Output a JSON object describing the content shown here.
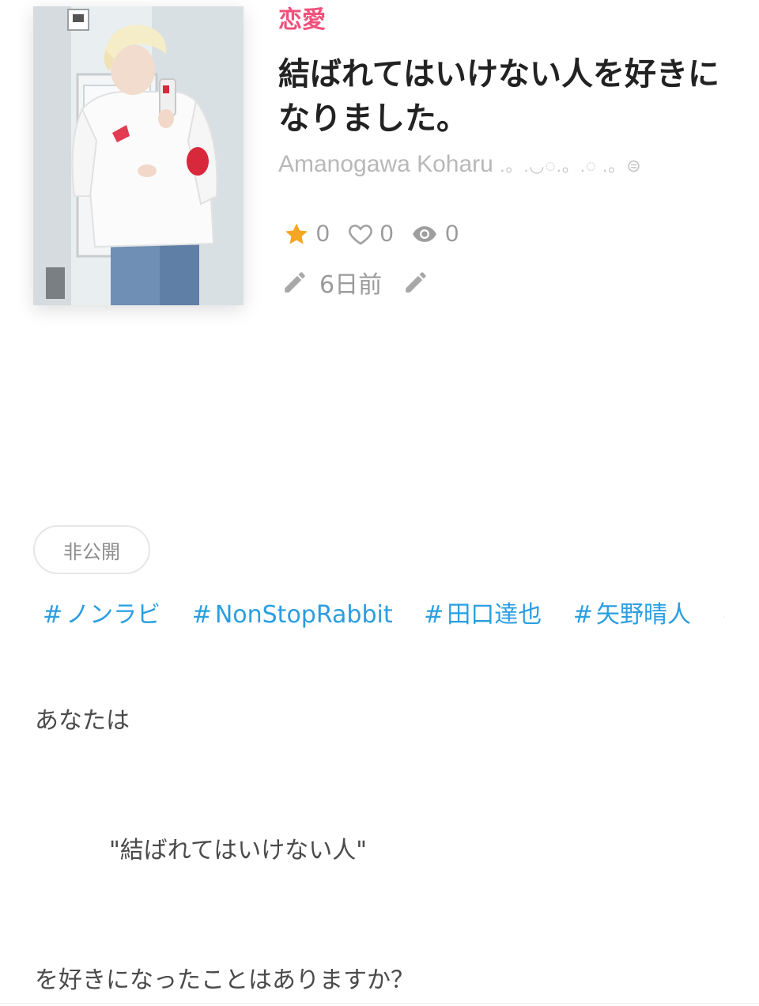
{
  "header": {
    "genre": "恋愛",
    "title": "結ばれてはいけない人を好きになりました。",
    "author_name": "Amanogawa Koharu",
    "author_decoration": ".。.◡◌.。.◌ .。⊜"
  },
  "stats": {
    "stars": "0",
    "likes": "0",
    "views": "0"
  },
  "meta": {
    "updated": "6日前"
  },
  "status": {
    "label": "非公開"
  },
  "tags": [
    {
      "hash": "#",
      "label": "ノンラビ"
    },
    {
      "hash": "#",
      "label": "NonStopRabbit"
    },
    {
      "hash": "#",
      "label": "田口達也"
    },
    {
      "hash": "#",
      "label": "矢野晴人"
    },
    {
      "hash": "#",
      "label": "松"
    }
  ],
  "story": {
    "line1": "あなたは",
    "line2": "\"結ばれてはいけない人\"",
    "line3": "を好きになったことはありますか？"
  },
  "colors": {
    "genre": "#f2507b",
    "tag": "#2a9ee0",
    "star": "#f5a623",
    "muted": "#9a9a9a"
  },
  "icons": {
    "star": "star-icon",
    "heart": "heart-icon",
    "eye": "eye-icon",
    "pencil": "pencil-icon"
  }
}
